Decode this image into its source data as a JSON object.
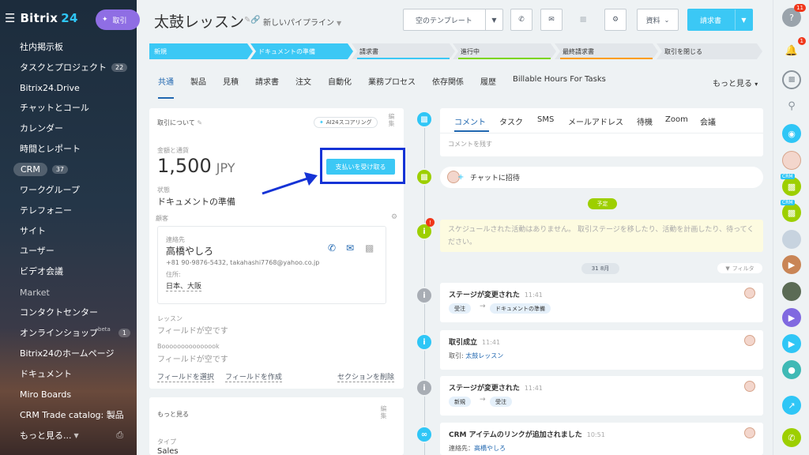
{
  "sidebar": {
    "brand_name": "Bitrix",
    "brand_num": "24",
    "ai_label": "取引",
    "items": [
      {
        "label": "社内掲示板",
        "count": ""
      },
      {
        "label": "タスクとプロジェクト",
        "count": "22"
      },
      {
        "label": "Bitrix24.Drive",
        "count": ""
      },
      {
        "label": "チャットとコール",
        "count": ""
      },
      {
        "label": "カレンダー",
        "count": ""
      },
      {
        "label": "時間とレポート",
        "count": ""
      },
      {
        "label": "CRM",
        "count": "37"
      },
      {
        "label": "ワークグループ",
        "count": ""
      },
      {
        "label": "テレフォニー",
        "count": ""
      },
      {
        "label": "サイト",
        "count": ""
      },
      {
        "label": "ユーザー",
        "count": ""
      },
      {
        "label": "ビデオ会議",
        "count": ""
      },
      {
        "label": "Market",
        "count": ""
      },
      {
        "label": "コンタクトセンター",
        "count": ""
      },
      {
        "label": "オンラインショップ",
        "count": "1",
        "sup": "beta"
      },
      {
        "label": "Bitrix24のホームページ",
        "count": ""
      },
      {
        "label": "ドキュメント",
        "count": ""
      },
      {
        "label": "Miro Boards",
        "count": ""
      },
      {
        "label": "CRM Trade catalog: 製品",
        "count": ""
      },
      {
        "label": "もっと見る...",
        "count": ""
      }
    ]
  },
  "header": {
    "title": "太鼓レッスン",
    "pipeline": "新しいパイプライン",
    "template_btn": "空のテンプレート",
    "docs_btn": "資料",
    "invoice_btn": "請求書"
  },
  "stages": [
    "新規",
    "ドキュメントの準備",
    "請求書",
    "進行中",
    "最終請求書",
    "取引を閉じる"
  ],
  "tabs": [
    "共通",
    "製品",
    "見積",
    "請求書",
    "注文",
    "自動化",
    "業務プロセス",
    "依存関係",
    "履歴",
    "Billable Hours For Tasks"
  ],
  "tabs_more": "もっと見る",
  "deal": {
    "section_title": "取引について",
    "edit": "編集",
    "ai_scoring": "AI24スコアリング",
    "amount_label": "金額と通貨",
    "amount": "1,500",
    "currency": "JPY",
    "pay_btn": "支払いを受け取る",
    "status_label": "状態",
    "status": "ドキュメントの準備",
    "client_label": "顧客",
    "contact_label": "連絡先",
    "contact_name": "高橋やしろ",
    "contact_phone": "+81 90-9876-5432, takahashi7768@yahoo.co.jp",
    "address_label": "住所:",
    "address": "日本、大阪",
    "field1_label": "レッスン",
    "field1_value": "フィールドが空です",
    "field2_label": "Booooooooooooook",
    "field2_value": "フィールドが空です",
    "select_field": "フィールドを選択",
    "create_field": "フィールドを作成",
    "delete_section": "セクションを削除"
  },
  "more_card": {
    "title": "もっと見る",
    "edit": "編集",
    "type_label": "タイプ",
    "type_value": "Sales"
  },
  "timeline": {
    "comm_tabs": [
      "コメント",
      "タスク",
      "SMS",
      "メールアドレス",
      "待機",
      "Zoom",
      "会議"
    ],
    "comment_placeholder": "コメントを残す",
    "chat_invite": "チャットに招待",
    "planned": "予定",
    "schedule_empty": "スケジュールされた活動はありません。 取引ステージを移したり、活動を計画したり、待ってください。",
    "date_chip": "31 8月",
    "filter": "フィルタ",
    "events": [
      {
        "title": "ステージが変更された",
        "time": "11:41",
        "from": "受注",
        "to": "ドキュメントの準備"
      },
      {
        "title": "取引成立",
        "time": "11:41",
        "label": "取引:",
        "link": "太鼓レッスン"
      },
      {
        "title": "ステージが変更された",
        "time": "11:41",
        "from": "新規",
        "to": "受注"
      },
      {
        "title": "CRM アイテムのリンクが追加されました",
        "time": "10:51",
        "label": "連絡先：",
        "link": "高橋やしろ"
      }
    ]
  },
  "rightbar": {
    "help_badge": "11",
    "bell_badge": "1",
    "crm_tag": "CRM"
  },
  "colors": {
    "accent": "#3bc8f5",
    "link": "#2067b0",
    "highlight_box": "#1533d6"
  }
}
